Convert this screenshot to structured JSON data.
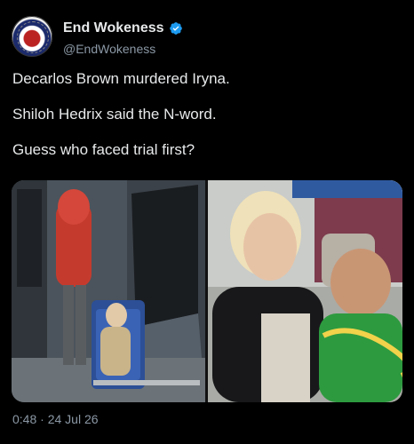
{
  "author": {
    "display_name": "End Wokeness",
    "handle": "@EndWokeness",
    "verified": true,
    "avatar_icon": "eagle-flag-badge-icon"
  },
  "tweet": {
    "lines": [
      "Decarlos Brown murdered Iryna.",
      "Shiloh Hedrix said the N-word.",
      "Guess who faced trial first?"
    ]
  },
  "media": {
    "count": 2
  },
  "meta": {
    "timestamp": "0:48 · 24 Jul 26"
  },
  "colors": {
    "background": "#000000",
    "text": "#e7e9ea",
    "secondary": "#8b98a5",
    "verified": "#1d9bf0"
  }
}
